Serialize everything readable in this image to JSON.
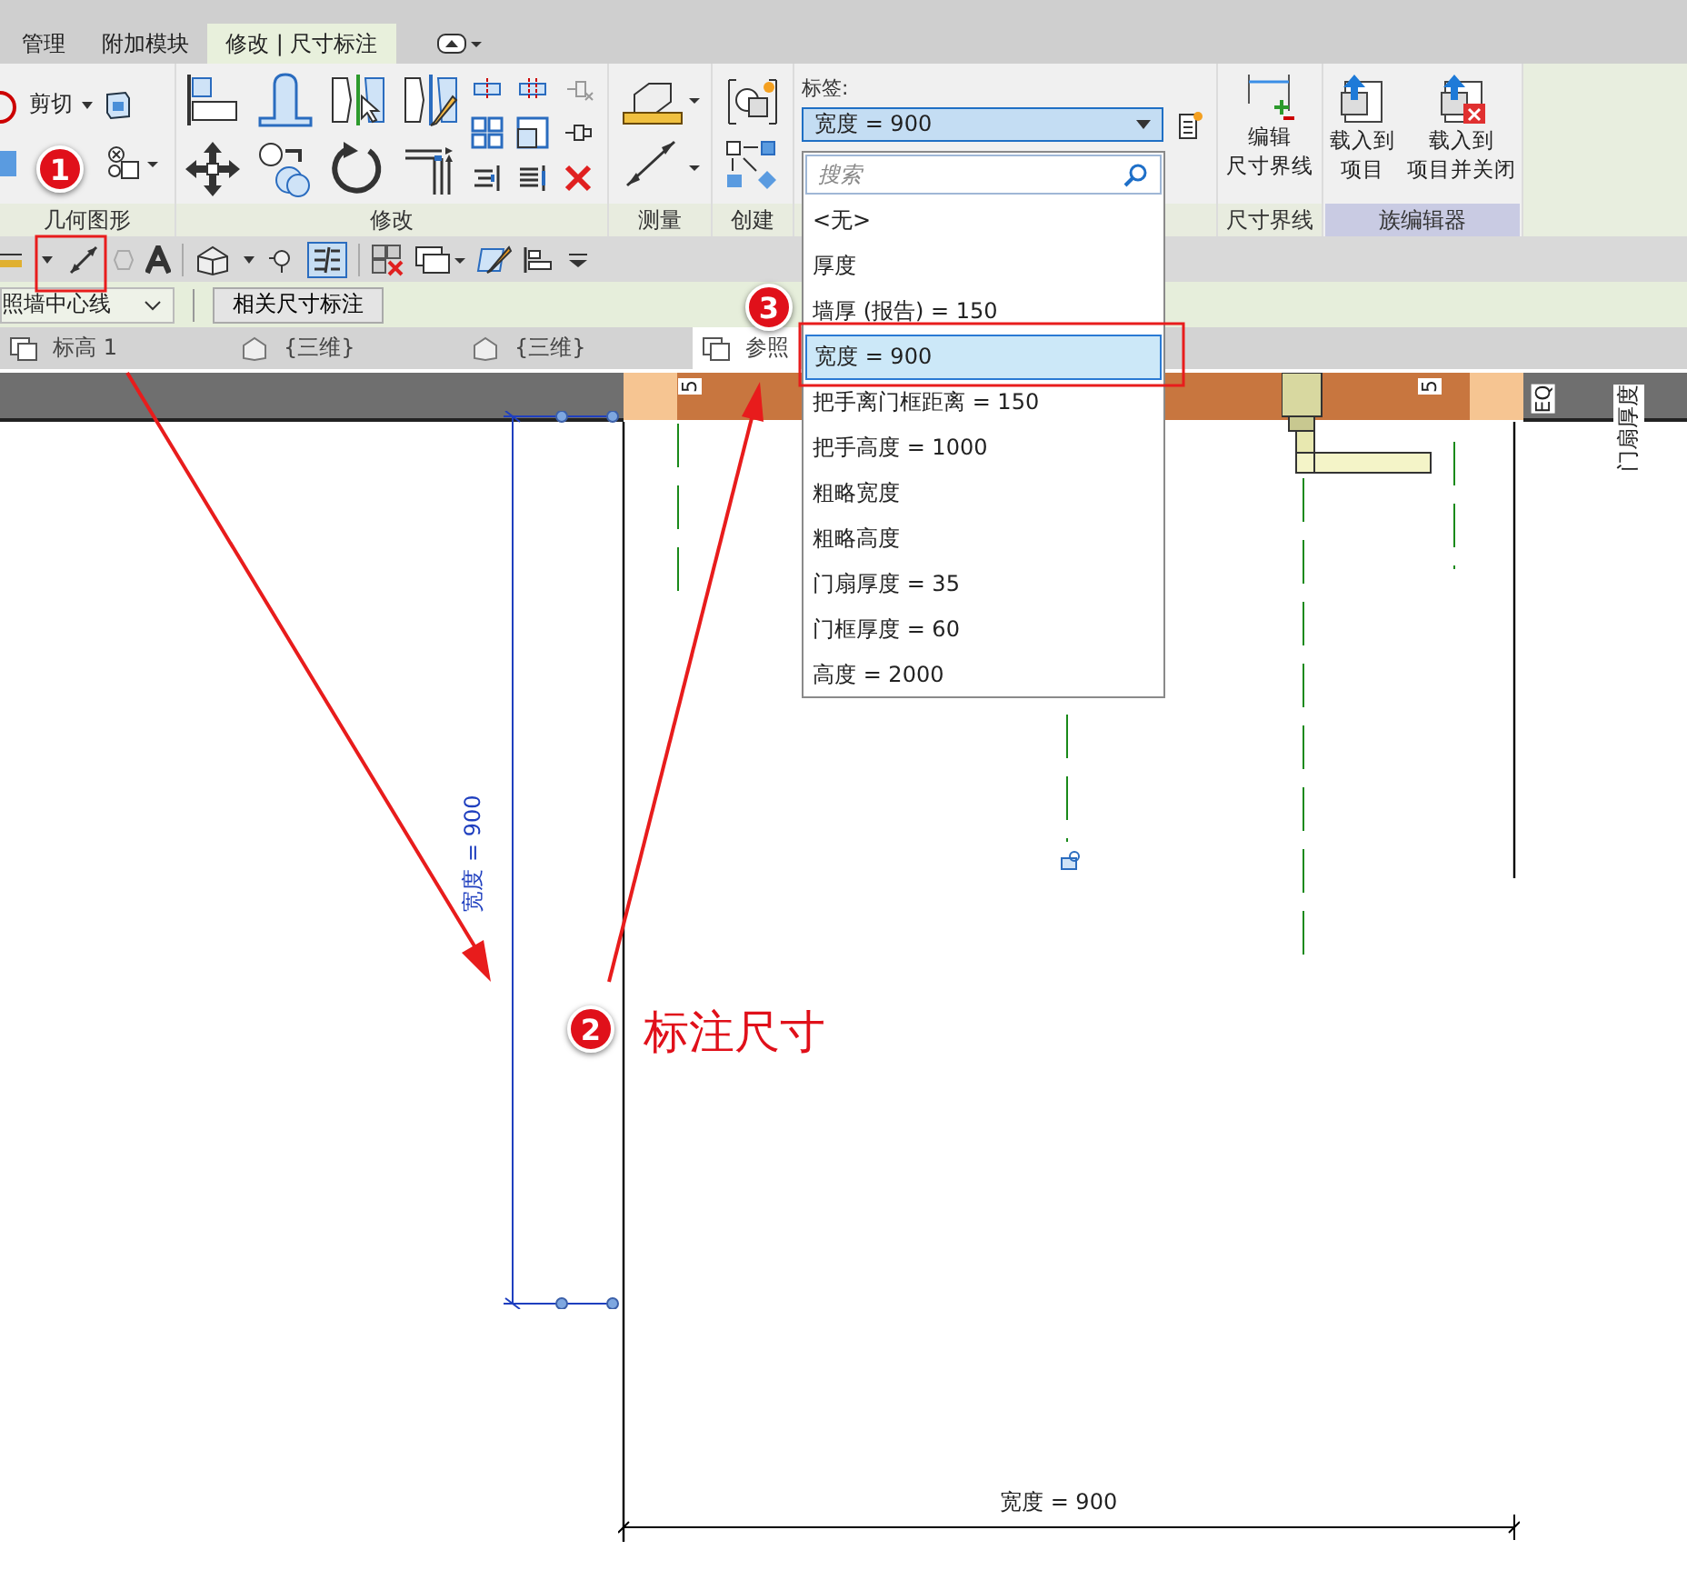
{
  "ribbon_tabs": [
    {
      "label": "管理",
      "selected": false
    },
    {
      "label": "附加模块",
      "selected": false
    },
    {
      "label": "修改 | 尺寸标注",
      "selected": true
    }
  ],
  "geometry_panel": {
    "title": "几何图形",
    "cut_label": "剪切"
  },
  "modify_panel": {
    "title": "修改"
  },
  "measure_panel": {
    "title": "测量"
  },
  "create_panel": {
    "title": "创建"
  },
  "label_panel": {
    "caption": "标签:",
    "value": "宽度 = 900",
    "search_placeholder": "搜索",
    "options": [
      {
        "label": "<无>",
        "selected": false
      },
      {
        "label": "厚度",
        "selected": false
      },
      {
        "label": "墙厚 (报告) = 150",
        "selected": false
      },
      {
        "label": "宽度 = 900",
        "selected": true
      },
      {
        "label": "把手离门框距离 = 150",
        "selected": false
      },
      {
        "label": "把手高度 = 1000",
        "selected": false
      },
      {
        "label": "粗略宽度",
        "selected": false
      },
      {
        "label": "粗略高度",
        "selected": false
      },
      {
        "label": "门扇厚度 = 35",
        "selected": false
      },
      {
        "label": "门框厚度 = 60",
        "selected": false
      },
      {
        "label": "高度 = 2000",
        "selected": false
      }
    ]
  },
  "witness_panel": {
    "title": "尺寸界线",
    "button_lines": [
      "编辑",
      "尺寸界线"
    ]
  },
  "family_editor_panel": {
    "title": "族编辑器",
    "buttons": [
      {
        "lines": [
          "载入到",
          "项目"
        ],
        "kind": "load"
      },
      {
        "lines": [
          "载入到",
          "项目并关闭"
        ],
        "kind": "load_close"
      }
    ]
  },
  "options_bar": {
    "dropdown_value": "照墙中心线",
    "button": "相关尺寸标注"
  },
  "view_tabs": [
    {
      "label": "标高 1",
      "kind": "plan",
      "selected": false
    },
    {
      "label": "{三维}",
      "kind": "perspective",
      "selected": false
    },
    {
      "label": "{三维}",
      "kind": "perspective",
      "selected": false
    },
    {
      "label": "参照",
      "kind": "plan",
      "selected": true
    }
  ],
  "canvas": {
    "vertical_dimension": "宽度 = 900",
    "bottom_dimension": "宽度 = 900",
    "dimension_marks": [
      "5",
      "5"
    ],
    "eq_label": "EQ",
    "door_thickness_label": "门扇厚度"
  },
  "callouts": [
    {
      "number": "1"
    },
    {
      "number": "2"
    },
    {
      "number": "3"
    }
  ],
  "callout_text": "标注尺寸"
}
